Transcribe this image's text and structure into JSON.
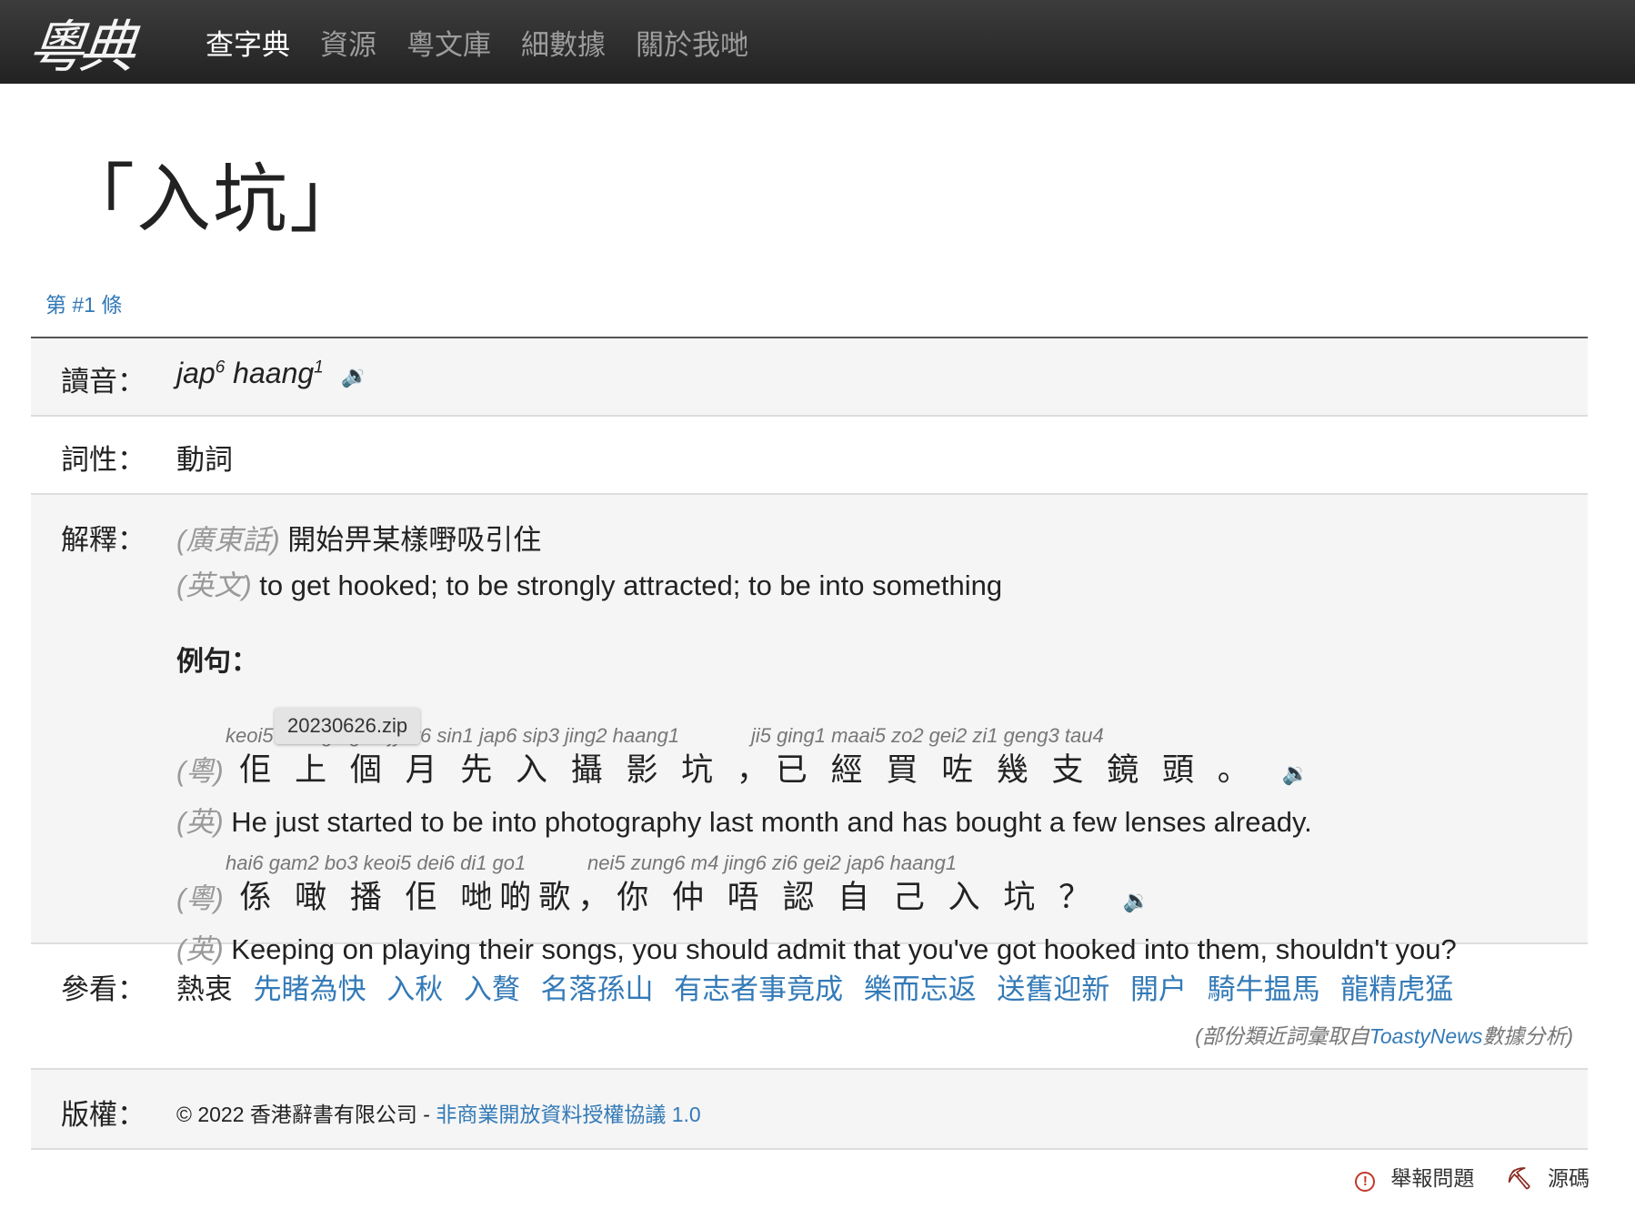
{
  "nav": {
    "logo": "粵典",
    "links": [
      "查字典",
      "資源",
      "粵文庫",
      "細數據",
      "關於我哋"
    ]
  },
  "headword": "「入坑」",
  "entry_num": "第 #1 條",
  "labels": {
    "pron": "讀音：",
    "pos": "詞性：",
    "def": "解釋：",
    "see": "參看：",
    "copy": "版權："
  },
  "pron": {
    "syl1": "jap",
    "tone1": "6",
    "syl2": "haang",
    "tone2": "1"
  },
  "pos": "動詞",
  "definition": {
    "yue_tag": "(廣東話)",
    "yue": "開始畀某樣嘢吸引住",
    "eng_tag": "(英文)",
    "eng": "to get hooked; to be strongly attracted; to be into something",
    "examples_title": "例句："
  },
  "examples": [
    {
      "jyut_a": "keoi5 soeng6 go3 jyut6 sin1 jap6 sip3 jing2 haang1",
      "jyut_b": "ji5  ging1 maai5 zo2 gei2  zi1  geng3 tau4",
      "yue_tag": "(粵)",
      "yue": "佢 上 個 月 先 入 攝 影  坑 ，已 經  買 咗 幾 支 鏡  頭 。",
      "eng_tag": "(英)",
      "eng": "He just started to be into photography last month and has bought a few lenses already."
    },
    {
      "jyut_a": "hai6 gam2 bo3 keoi5 dei6 di1  go1",
      "jyut_b": "nei5 zung6 m4 jing6  zi6  gei2 jap6 haang1",
      "yue_tag": "(粵)",
      "yue": "係 噉 播 佢 哋啲歌，你 仲 唔 認 自 己 入  坑  ？",
      "eng_tag": "(英)",
      "eng": "Keeping on playing their songs, you should admit that you've got hooked into them, shouldn't you?"
    }
  ],
  "tooltip": "20230626.zip",
  "see_also": {
    "plain": "熱衷",
    "links": [
      "先睹為快",
      "入秋",
      "入贅",
      "名落孫山",
      "有志者事竟成",
      "樂而忘返",
      "送舊迎新",
      "開户",
      "騎牛揾馬",
      "龍精虎猛"
    ],
    "note_pre": "(部份類近詞彙取自",
    "note_link": "ToastyNews",
    "note_post": "數據分析)"
  },
  "copyright": {
    "text": "© 2022 香港辭書有限公司 - ",
    "link": "非商業開放資料授權協議 1.0"
  },
  "footer": {
    "report": "舉報問題",
    "source": "源碼"
  }
}
